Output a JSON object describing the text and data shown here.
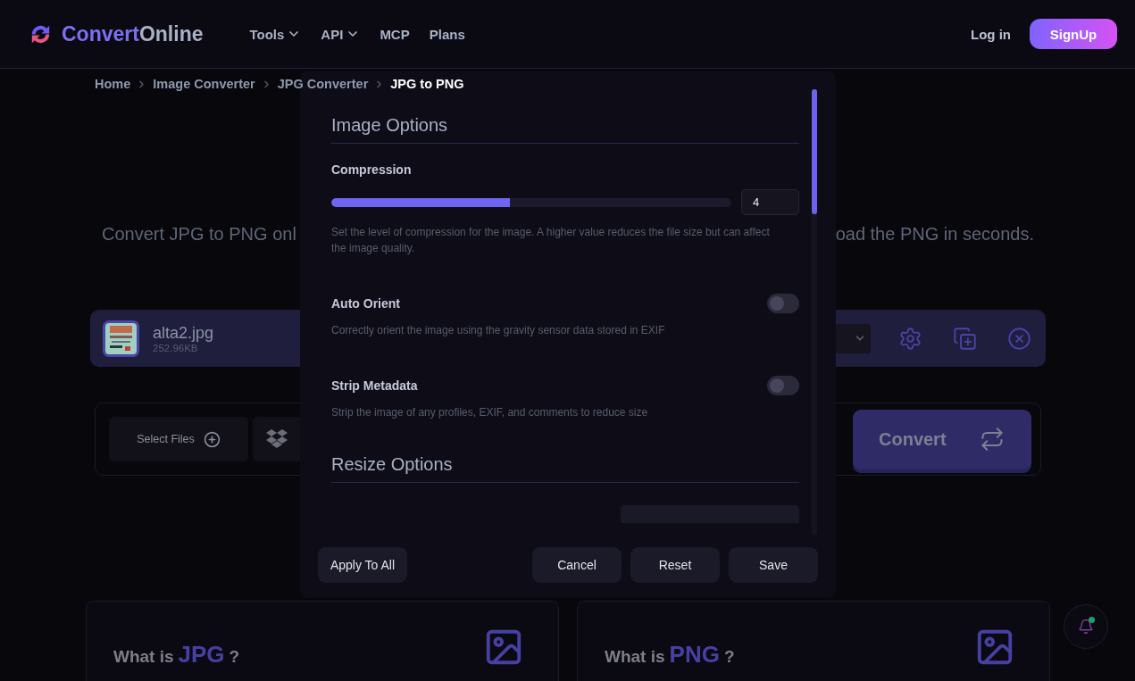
{
  "header": {
    "logo": {
      "part_1": "Convert",
      "part_2": "Online"
    },
    "nav": [
      {
        "label": "Tools",
        "has_menu": true
      },
      {
        "label": "API",
        "has_menu": true
      },
      {
        "label": "MCP",
        "has_menu": false
      },
      {
        "label": "Plans",
        "has_menu": false
      }
    ],
    "login": "Log in",
    "signup": "SignUp"
  },
  "breadcrumb": [
    {
      "label": "Home",
      "current": false
    },
    {
      "label": "Image Converter",
      "current": false
    },
    {
      "label": "JPG Converter",
      "current": false
    },
    {
      "label": "JPG to PNG",
      "current": true
    }
  ],
  "hero": {
    "text_left": "Convert JPG to PNG onl",
    "text_right": "oad the PNG in seconds."
  },
  "file": {
    "name": "alta2.jpg",
    "size": "252.96KB"
  },
  "actions": {
    "select_files": "Select Files",
    "convert": "Convert"
  },
  "cards": [
    {
      "prefix": "What is",
      "format": "JPG",
      "suffix": "?"
    },
    {
      "prefix": "What is",
      "format": "PNG",
      "suffix": "?"
    }
  ],
  "notifications": {
    "unread": true
  },
  "dialog": {
    "sections": [
      {
        "title": "Image Options",
        "options": [
          {
            "kind": "slider",
            "label": "Compression",
            "level": 0.446,
            "value": "4",
            "description": "Set the level of compression for the image. A higher value reduces the file size but can affect the image quality."
          },
          {
            "kind": "toggle",
            "label": "Auto Orient",
            "on": false,
            "description": "Correctly orient the image using the gravity sensor data stored in EXIF"
          },
          {
            "kind": "toggle",
            "label": "Strip Metadata",
            "on": false,
            "description": "Strip the image of any profiles, EXIF, and comments to reduce size"
          }
        ]
      },
      {
        "title": "Resize Options",
        "options": [
          {
            "kind": "field"
          }
        ]
      }
    ],
    "left_buttons": [
      "Apply To All"
    ],
    "right_buttons": [
      "Cancel",
      "Reset",
      "Save"
    ]
  }
}
